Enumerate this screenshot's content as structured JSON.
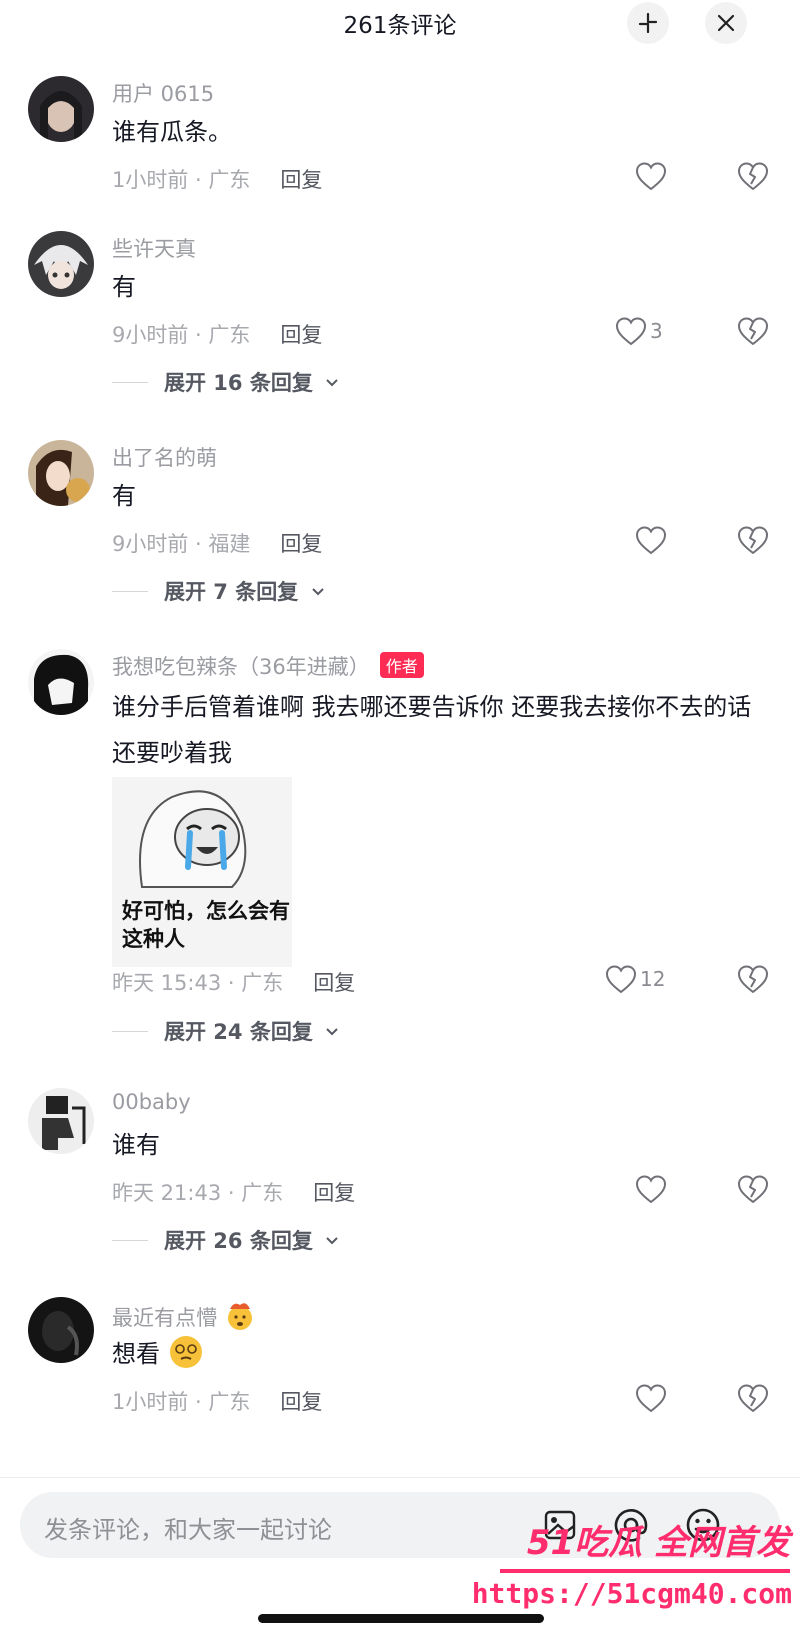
{
  "header": {
    "title": "261条评论"
  },
  "comments": [
    {
      "user": "用户 0615",
      "text": "谁有瓜条。",
      "time": "1小时前 · 广东",
      "reply": "回复",
      "likes": "",
      "expand": ""
    },
    {
      "user": "些许天真",
      "text": "有",
      "time": "9小时前 · 广东",
      "reply": "回复",
      "likes": "3",
      "expand": "展开 16 条回复"
    },
    {
      "user": "出了名的萌",
      "text": "有",
      "time": "9小时前 · 福建",
      "reply": "回复",
      "likes": "",
      "expand": "展开 7 条回复"
    },
    {
      "user": "我想吃包辣条（36年进藏）",
      "badge": "作者",
      "text": "谁分手后管着谁啊 我去哪还要告诉你 还要我去接你不去的话还要吵着我",
      "sticker_text": "好可怕，怎么会有这种人",
      "time": "昨天 15:43 · 广东",
      "reply": "回复",
      "likes": "12",
      "expand": "展开 24 条回复"
    },
    {
      "user": "00baby",
      "text": "谁有",
      "time": "昨天 21:43 · 广东",
      "reply": "回复",
      "likes": "",
      "expand": "展开 26 条回复"
    },
    {
      "user": "最近有点懵",
      "text": "想看",
      "time": "1小时前 · 广东",
      "reply": "回复",
      "likes": "",
      "expand": ""
    }
  ],
  "input": {
    "placeholder": "发条评论，和大家一起讨论"
  },
  "watermark": {
    "line1": "51吃瓜 全网首发",
    "line2": "https://51cgm40.com"
  },
  "colors": {
    "accent": "#fe2c55",
    "watermark": "#ff2d6d"
  }
}
